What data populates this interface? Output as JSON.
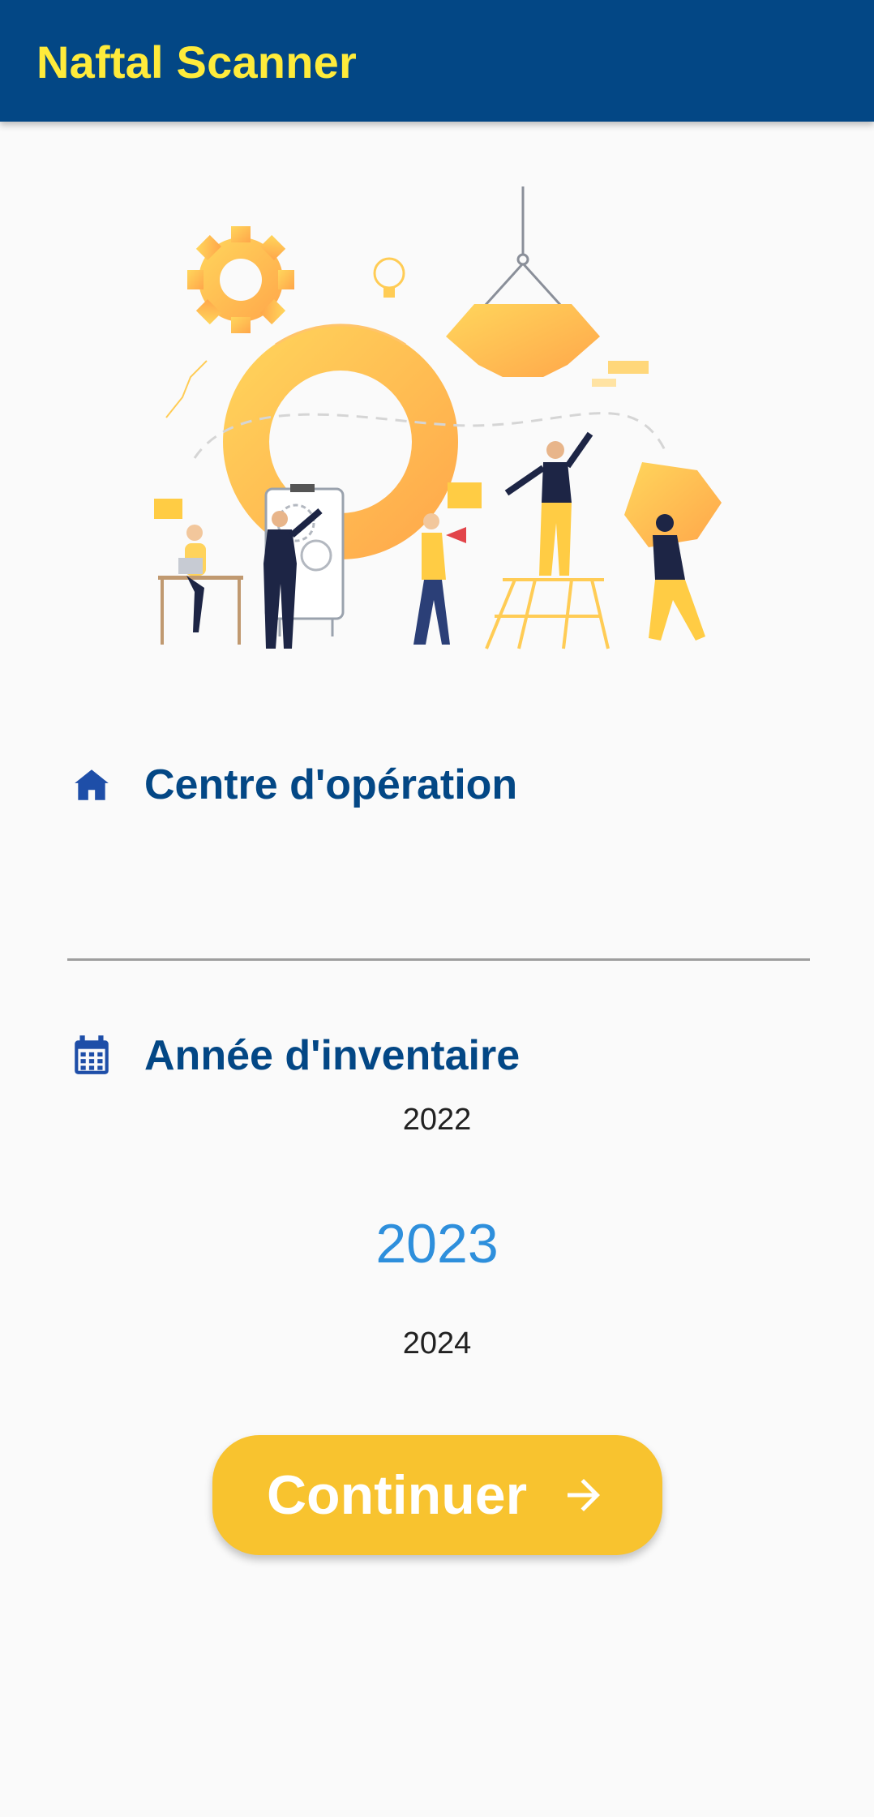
{
  "app": {
    "title": "Naftal Scanner"
  },
  "illustration": {
    "name": "teamwork-gears-illustration"
  },
  "centre": {
    "label": "Centre d'opération",
    "icon": "home-icon",
    "value": ""
  },
  "inventory": {
    "label": "Année d'inventaire",
    "icon": "calendar-icon",
    "years": {
      "previous": "2022",
      "selected": "2023",
      "next": "2024"
    }
  },
  "actions": {
    "continue_label": "Continuer",
    "continue_icon": "arrow-right-icon"
  },
  "colors": {
    "primary": "#034785",
    "appbar_title": "#ffeb3b",
    "accent": "#f8c32f",
    "selected_year": "#2e8fdc",
    "background": "#fafafa"
  }
}
